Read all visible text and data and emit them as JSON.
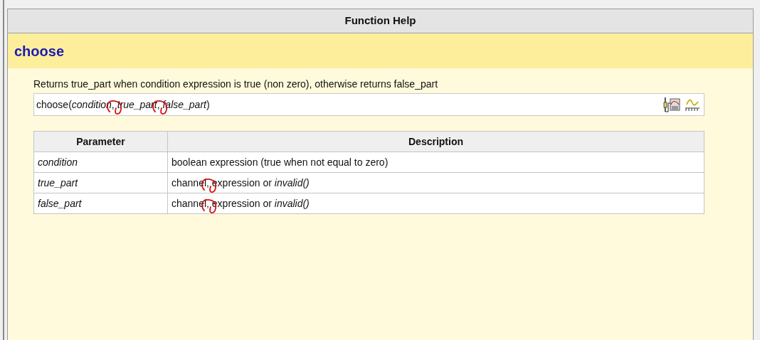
{
  "panel": {
    "title": "Function Help"
  },
  "function": {
    "name": "choose",
    "summary": "Returns true_part when condition expression is true (non zero), otherwise returns false_part",
    "signature": [
      {
        "text": "choose(",
        "italic": false,
        "circled": false
      },
      {
        "text": "condition",
        "italic": true,
        "circled": false
      },
      {
        "text": ", ",
        "italic": false,
        "circled": true
      },
      {
        "text": "true_part",
        "italic": true,
        "circled": false
      },
      {
        "text": ", ",
        "italic": false,
        "circled": true
      },
      {
        "text": "false_part",
        "italic": true,
        "circled": false
      },
      {
        "text": ")",
        "italic": false,
        "circled": false
      }
    ]
  },
  "table": {
    "columns": [
      "Parameter",
      "Description"
    ],
    "rows": [
      {
        "parameter": "condition",
        "description": [
          {
            "text": "boolean expression (true when not equal to zero)",
            "italic": false,
            "circled": false
          }
        ]
      },
      {
        "parameter": "true_part",
        "description": [
          {
            "text": "channel",
            "italic": false,
            "circled": false
          },
          {
            "text": ", ",
            "italic": false,
            "circled": true
          },
          {
            "text": "expression or ",
            "italic": false,
            "circled": false
          },
          {
            "text": "invalid()",
            "italic": true,
            "circled": false
          }
        ]
      },
      {
        "parameter": "false_part",
        "description": [
          {
            "text": "channel",
            "italic": false,
            "circled": false
          },
          {
            "text": ", ",
            "italic": false,
            "circled": true
          },
          {
            "text": "expression or ",
            "italic": false,
            "circled": false
          },
          {
            "text": "invalid()",
            "italic": true,
            "circled": false
          }
        ]
      }
    ]
  }
}
